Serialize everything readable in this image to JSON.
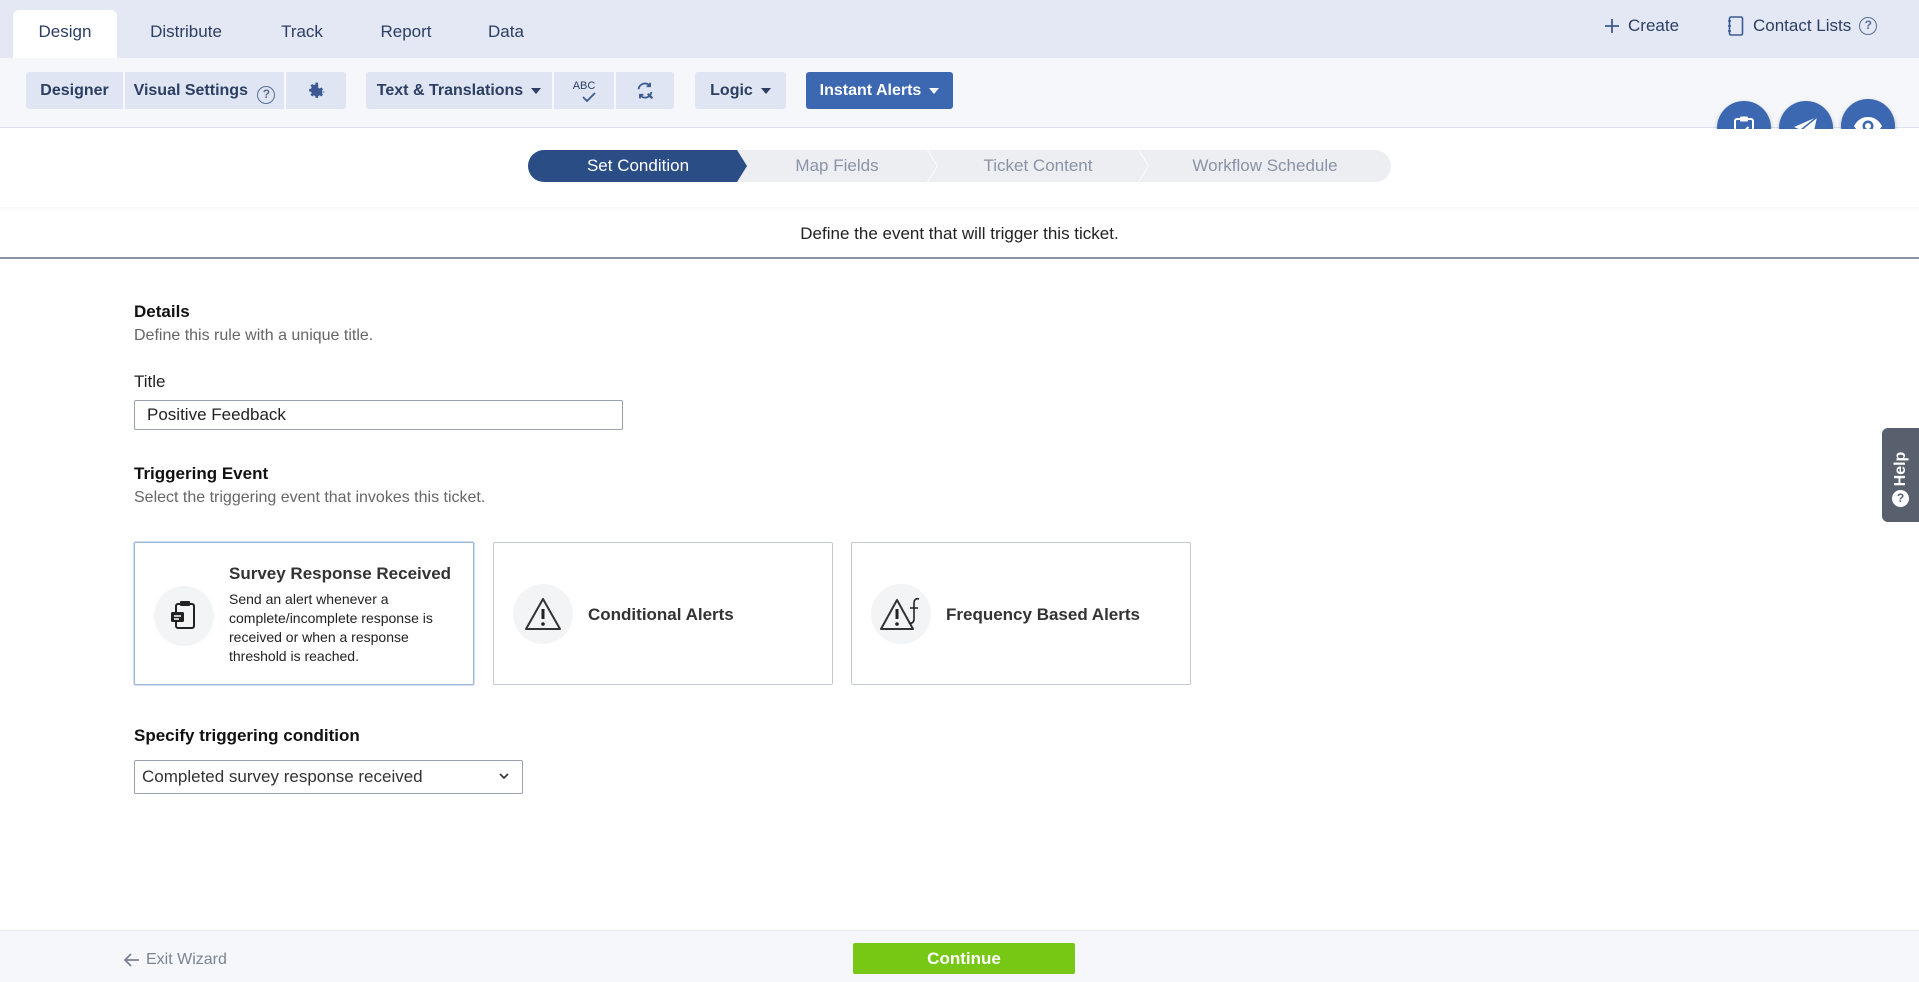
{
  "tabs": [
    {
      "label": "Design",
      "active": true
    },
    {
      "label": "Distribute",
      "active": false
    },
    {
      "label": "Track",
      "active": false
    },
    {
      "label": "Report",
      "active": false
    },
    {
      "label": "Data",
      "active": false
    }
  ],
  "top_right": {
    "create_label": "Create",
    "contact_lists_label": "Contact Lists",
    "help_glyph": "?"
  },
  "toolbar": {
    "designer": "Designer",
    "visual_settings": "Visual Settings",
    "text_translations": "Text & Translations",
    "spellcheck_abc": "ABC",
    "logic": "Logic",
    "instant_alerts": "Instant Alerts"
  },
  "stepper": {
    "steps": [
      "Set Condition",
      "Map Fields",
      "Ticket Content",
      "Workflow Schedule"
    ],
    "active_index": 0
  },
  "subtitle": "Define the event that will trigger this ticket.",
  "details": {
    "heading": "Details",
    "description": "Define this rule with a unique title.",
    "title_label": "Title",
    "title_value": "Positive Feedback"
  },
  "triggering": {
    "heading": "Triggering Event",
    "description": "Select the triggering event that invokes this ticket.",
    "cards": [
      {
        "title": "Survey Response Received",
        "description": "Send an alert whenever a complete/incomplete response is received or when a response threshold is reached.",
        "selected": true,
        "icon": "clipboard-icon"
      },
      {
        "title": "Conditional Alerts",
        "description": "",
        "selected": false,
        "icon": "warning-icon"
      },
      {
        "title": "Frequency Based Alerts",
        "description": "",
        "selected": false,
        "icon": "warning-function-icon"
      }
    ]
  },
  "condition": {
    "heading": "Specify triggering condition",
    "selected": "Completed survey response received"
  },
  "help_tab": {
    "label": "Help",
    "glyph": "?"
  },
  "footer": {
    "exit_label": "Exit Wizard",
    "continue_label": "Continue"
  },
  "colors": {
    "primary": "#3c67b1",
    "active_step": "#2b4d86",
    "continue": "#76c814"
  }
}
